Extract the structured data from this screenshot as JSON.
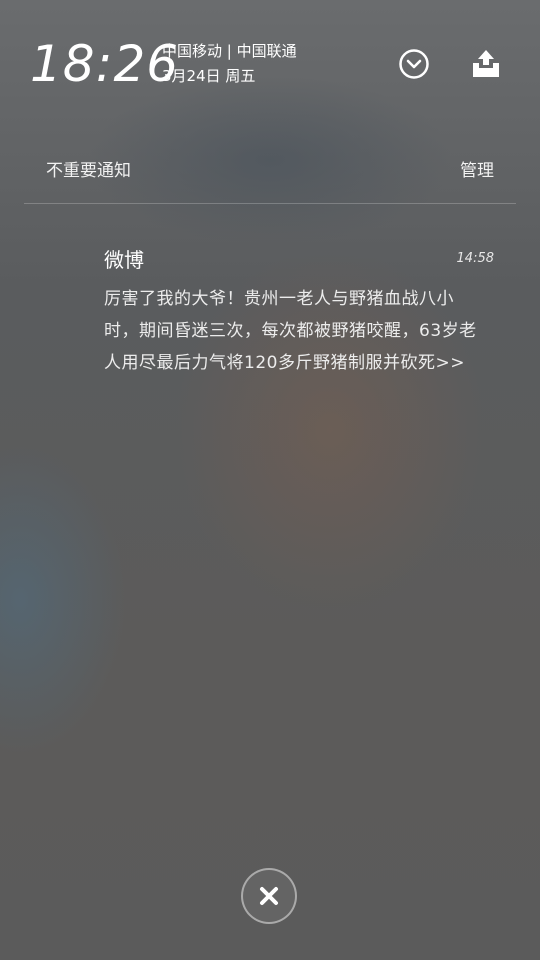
{
  "status_bar": {
    "time": "18:26",
    "carrier": "中国移动 | 中国联通",
    "date": "3月24日  周五"
  },
  "icons": {
    "expand": "chevron-down-circle-icon",
    "upload": "tray-upload-icon",
    "close": "close-icon"
  },
  "section": {
    "title": "不重要通知",
    "manage_label": "管理"
  },
  "notification": {
    "app": "微博",
    "time": "14:58",
    "text": "厉害了我的大爷！贵州一老人与野猪血战八小时，期间昏迷三次，每次都被野猪咬醒，63岁老人用尽最后力气将120多斤野猪制服并砍死>>"
  }
}
